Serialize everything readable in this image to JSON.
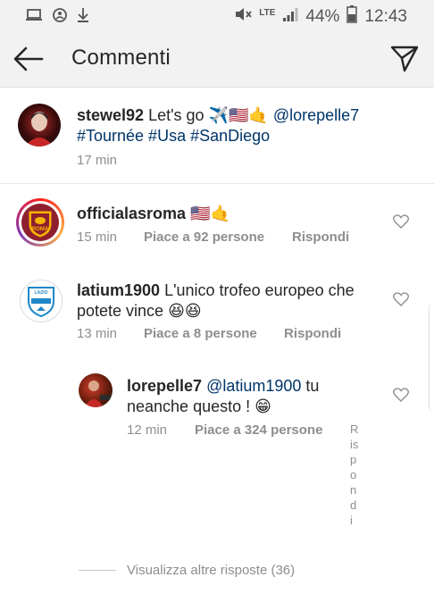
{
  "status_bar": {
    "network": "LTE",
    "battery": "44%",
    "time": "12:43",
    "icons": [
      "laptop-icon",
      "data-saver-icon",
      "download-icon",
      "mute-icon",
      "signal-icon",
      "battery-icon"
    ]
  },
  "header": {
    "title": "Commenti",
    "back_icon": "arrow-left-icon",
    "send_icon": "paper-plane-icon"
  },
  "caption": {
    "username": "stewel92",
    "text_start": "Let's go ✈️🇺🇸🤙 ",
    "mention": "@lorepelle7",
    "hashtags": "#Tournée #Usa #SanDiego",
    "time": "17 min"
  },
  "comments": [
    {
      "username": "officialasroma",
      "text": "🇺🇸🤙",
      "time": "15 min",
      "likes": "Piace a 92 persone",
      "reply": "Rispondi"
    },
    {
      "username": "latium1900",
      "text": "L'unico trofeo europeo che potete vince 😆😆",
      "time": "13 min",
      "likes": "Piace a 8 persone",
      "reply": "Rispondi"
    }
  ],
  "reply_comment": {
    "username": "lorepelle7",
    "mention": "@latium1900",
    "text": "tu neanche questo ! 😁",
    "time": "12 min",
    "likes": "Piace a 324 persone",
    "reply_cut": "Rispondi"
  },
  "view_more": "Visualizza altre risposte (36)",
  "avatar_labels": {
    "roma": "ROMA",
    "lazio": "LAZIO"
  }
}
